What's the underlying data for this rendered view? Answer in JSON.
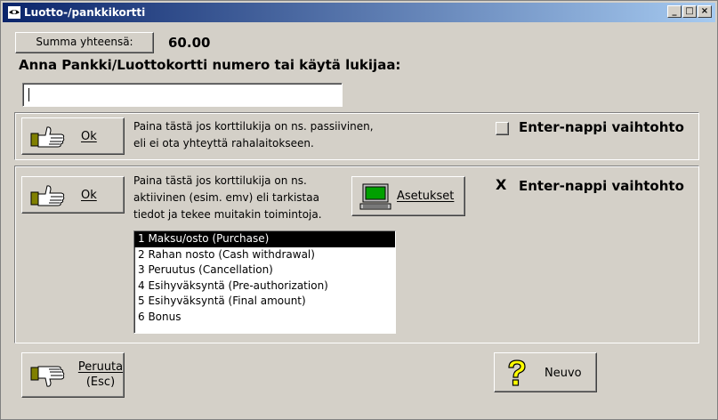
{
  "window": {
    "title": "Luotto-/pankkikortti",
    "controls": [
      "_",
      "□",
      "×"
    ]
  },
  "summary": {
    "button_label": "Summa yhteensä:",
    "amount": "60.00"
  },
  "prompt": "Anna Pankki/Luottokortti numero tai käytä lukijaa:",
  "card_input": {
    "value": "",
    "placeholder": ""
  },
  "passive": {
    "ok_label": "Ok",
    "desc_line1": "Paina tästä jos korttilukija on ns. passiivinen,",
    "desc_line2": "eli ei ota yhteyttä rahalaitokseen.",
    "enter_label": "Enter-nappi vaihtohto",
    "enter_checked": false
  },
  "active": {
    "ok_label": "Ok",
    "desc_line1": "Paina tästä jos korttilukija on ns.",
    "desc_line2": "aktiivinen (esim. emv) eli tarkistaa",
    "desc_line3": "tiedot ja tekee muitakin toimintoja.",
    "settings_label": "Asetukset",
    "enter_label": "Enter-nappi vaihtohto",
    "enter_checked": true,
    "enter_mark": "X"
  },
  "transaction_types": [
    "1 Maksu/osto (Purchase)",
    "2 Rahan nosto (Cash withdrawal)",
    "3 Peruutus (Cancellation)",
    "4 Esihyväksyntä (Pre-authorization)",
    "5 Esihyväksyntä (Final amount)",
    "6 Bonus"
  ],
  "selected_index": 0,
  "cancel": {
    "line1": "Peruuta",
    "line2": "(Esc)"
  },
  "help": {
    "label": "Neuvo"
  },
  "icons": {
    "title": "eye-icon",
    "ok": "thumbs-up-hand-icon",
    "cancel": "thumbs-down-hand-icon",
    "settings": "computer-icon",
    "help": "question-mark-icon"
  }
}
